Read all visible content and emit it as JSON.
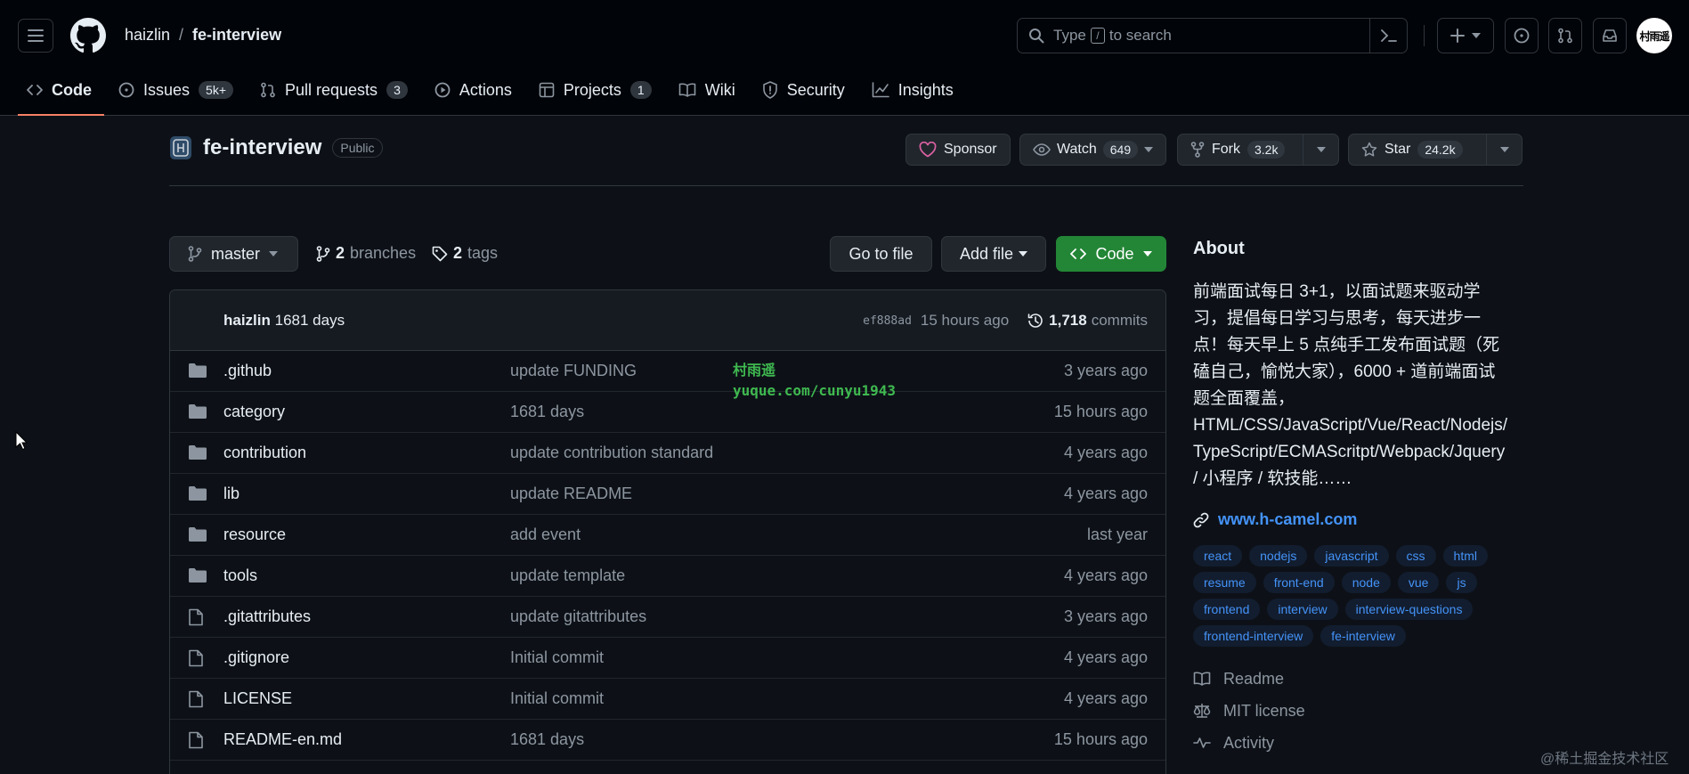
{
  "header": {
    "owner": "haizlin",
    "separator": "/",
    "repo": "fe-interview",
    "search_prefix": "Type",
    "search_key": "/",
    "search_suffix": "to search",
    "avatar_text": "村雨遥"
  },
  "tabs": [
    {
      "label": "Code",
      "icon": "code-icon",
      "counter": ""
    },
    {
      "label": "Issues",
      "icon": "issue-icon",
      "counter": "5k+"
    },
    {
      "label": "Pull requests",
      "icon": "pull-request-icon",
      "counter": "3"
    },
    {
      "label": "Actions",
      "icon": "play-icon",
      "counter": ""
    },
    {
      "label": "Projects",
      "icon": "table-icon",
      "counter": "1"
    },
    {
      "label": "Wiki",
      "icon": "book-icon",
      "counter": ""
    },
    {
      "label": "Security",
      "icon": "shield-icon",
      "counter": ""
    },
    {
      "label": "Insights",
      "icon": "graph-icon",
      "counter": ""
    }
  ],
  "repo": {
    "name": "fe-interview",
    "visibility": "Public",
    "sponsor_label": "Sponsor",
    "watch_label": "Watch",
    "watch_count": "649",
    "fork_label": "Fork",
    "fork_count": "3.2k",
    "star_label": "Star",
    "star_count": "24.2k"
  },
  "branchbar": {
    "branch": "master",
    "branches_count": "2",
    "branches_label": "branches",
    "tags_count": "2",
    "tags_label": "tags",
    "go_to_file": "Go to file",
    "add_file": "Add file",
    "code_label": "Code"
  },
  "commit": {
    "author": "haizlin",
    "message": "1681 days",
    "sha": "ef888ad",
    "time": "15 hours ago",
    "count": "1,718",
    "count_label": "commits"
  },
  "files": [
    {
      "name": ".github",
      "type": "dir",
      "message": "update FUNDING",
      "date": "3 years ago"
    },
    {
      "name": "category",
      "type": "dir",
      "message": "1681 days",
      "date": "15 hours ago"
    },
    {
      "name": "contribution",
      "type": "dir",
      "message": "update contribution standard",
      "date": "4 years ago"
    },
    {
      "name": "lib",
      "type": "dir",
      "message": "update README",
      "date": "4 years ago"
    },
    {
      "name": "resource",
      "type": "dir",
      "message": "add event",
      "date": "last year"
    },
    {
      "name": "tools",
      "type": "dir",
      "message": "update template",
      "date": "4 years ago"
    },
    {
      "name": ".gitattributes",
      "type": "file",
      "message": "update gitattributes",
      "date": "3 years ago"
    },
    {
      "name": ".gitignore",
      "type": "file",
      "message": "Initial commit",
      "date": "4 years ago"
    },
    {
      "name": "LICENSE",
      "type": "file",
      "message": "Initial commit",
      "date": "4 years ago"
    },
    {
      "name": "README-en.md",
      "type": "file",
      "message": "1681 days",
      "date": "15 hours ago"
    }
  ],
  "watermark": {
    "line1": "村雨遥",
    "line2": "yuque.com/cunyu1943"
  },
  "about": {
    "title": "About",
    "description_lines": [
      "前端面试每日 3+1，以面试题来驱动学",
      "习，提倡每日学习与思考，每天进步一",
      "点！每天早上 5 点纯手工发布面试题（死",
      "磕自己，愉悦大家），6000 + 道前端面试",
      "题全面覆盖，",
      "HTML/CSS/JavaScript/Vue/React/Nodejs/",
      "TypeScript/ECMAScritpt/Webpack/Jquery",
      "/ 小程序 / 软技能……"
    ],
    "website": "www.h-camel.com",
    "topics": [
      "react",
      "nodejs",
      "javascript",
      "css",
      "html",
      "resume",
      "front-end",
      "node",
      "vue",
      "js",
      "frontend",
      "interview",
      "interview-questions",
      "frontend-interview",
      "fe-interview"
    ],
    "readme_label": "Readme",
    "license_label": "MIT license",
    "activity_label": "Activity"
  },
  "footer_watermark": "@稀土掘金技术社区",
  "colors": {
    "background": "#0d1117",
    "header": "#010409",
    "border": "#30363d",
    "accent_link": "#4493f8",
    "code_button": "#238636",
    "tab_underline": "#f78166",
    "sponsor_heart": "#db61a2"
  }
}
